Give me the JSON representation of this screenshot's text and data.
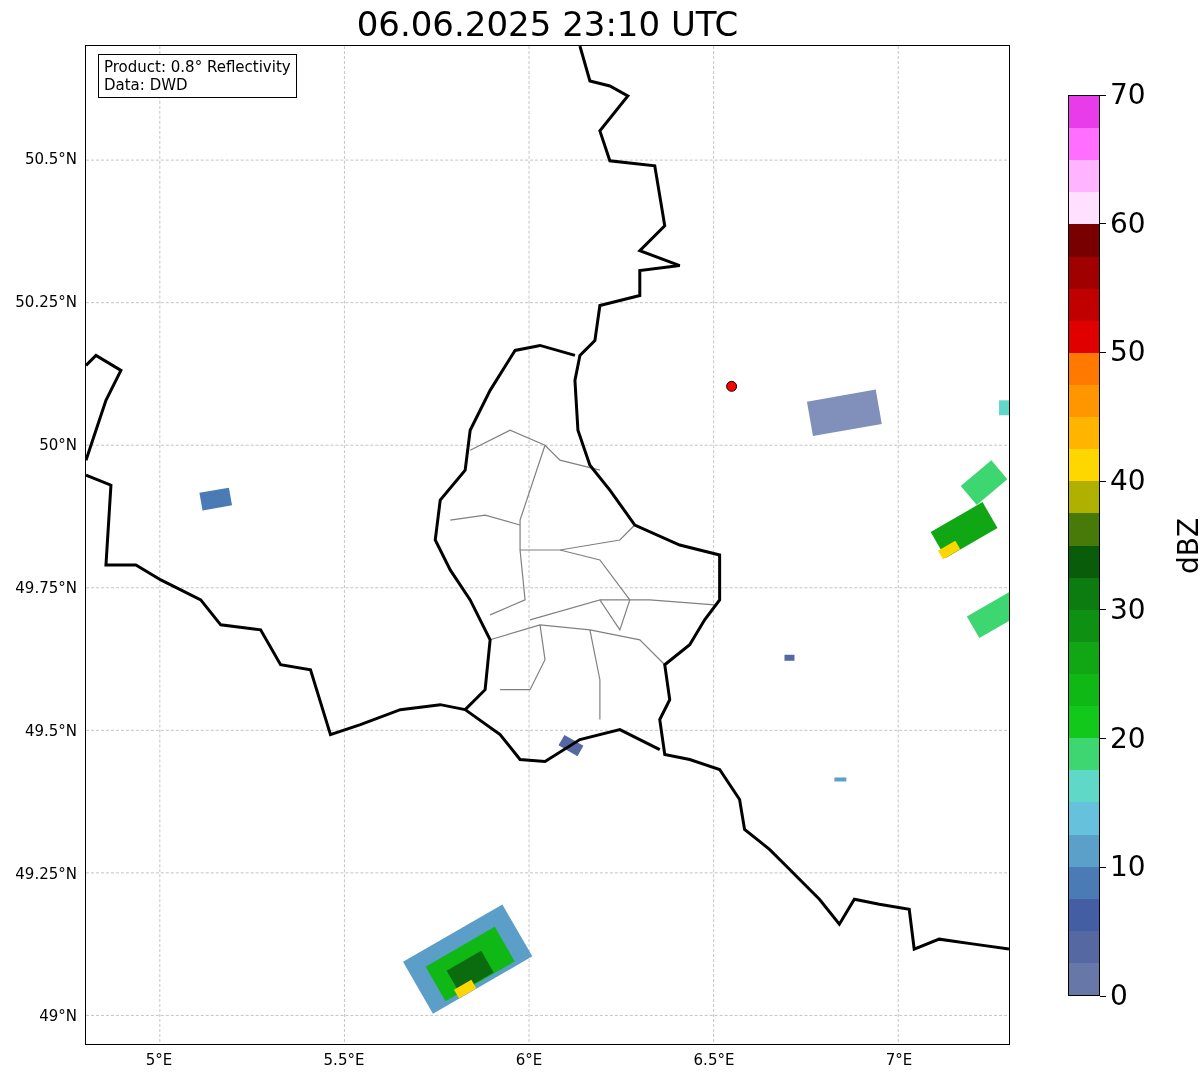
{
  "title": "06.06.2025 23:10 UTC",
  "legend": [
    "Product: 0.8° Reflectivity",
    "Data: DWD"
  ],
  "x_ticks": [
    "5°E",
    "5.5°E",
    "6°E",
    "6.5°E",
    "7°E"
  ],
  "y_ticks": [
    "50.5°N",
    "50.25°N",
    "50°N",
    "49.75°N",
    "49.5°N",
    "49.25°N",
    "49°N"
  ],
  "colorbar": {
    "label": "dBZ",
    "ticks": [
      "70",
      "60",
      "50",
      "40",
      "30",
      "20",
      "10",
      "0"
    ],
    "bins": [
      {
        "color": "#e83ceb"
      },
      {
        "color": "#ff6eff"
      },
      {
        "color": "#ffb4ff"
      },
      {
        "color": "#ffe0ff"
      },
      {
        "color": "#780000"
      },
      {
        "color": "#a00000"
      },
      {
        "color": "#c00000"
      },
      {
        "color": "#e00000"
      },
      {
        "color": "#ff7800"
      },
      {
        "color": "#ff9600"
      },
      {
        "color": "#ffb400"
      },
      {
        "color": "#ffd700"
      },
      {
        "color": "#b0b000"
      },
      {
        "color": "#487a0a"
      },
      {
        "color": "#085c0a"
      },
      {
        "color": "#0c7c10"
      },
      {
        "color": "#0e9112"
      },
      {
        "color": "#10a614"
      },
      {
        "color": "#10b816"
      },
      {
        "color": "#12c81a"
      },
      {
        "color": "#3dd670"
      },
      {
        "color": "#60d8c8"
      },
      {
        "color": "#66c2dc"
      },
      {
        "color": "#5aa0c8"
      },
      {
        "color": "#4a7bb5"
      },
      {
        "color": "#445ea3"
      },
      {
        "color": "#5568a2"
      },
      {
        "color": "#6677a8"
      }
    ]
  }
}
